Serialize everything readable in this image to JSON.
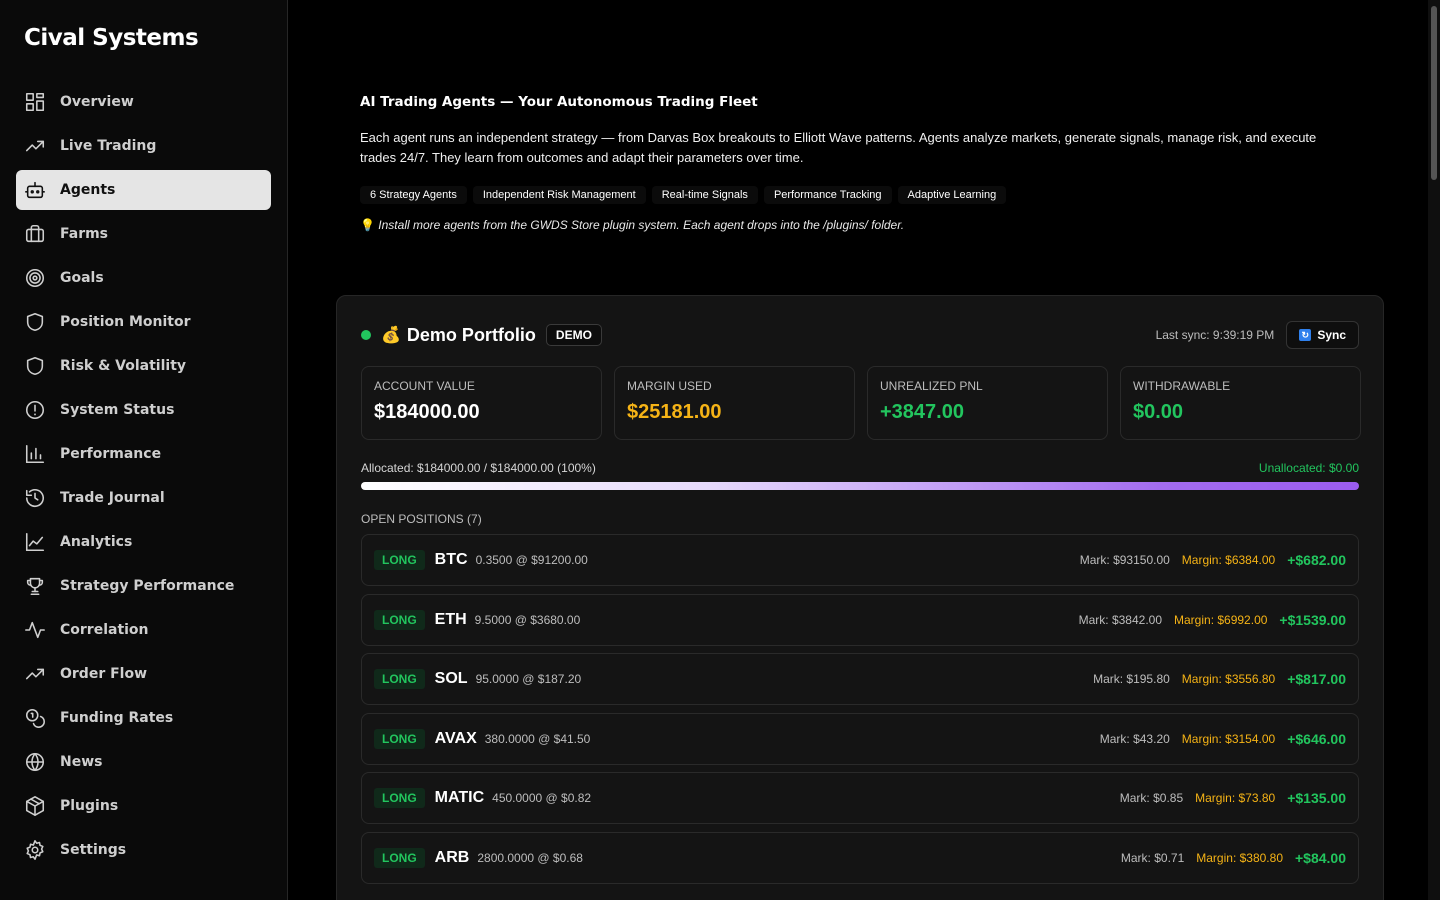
{
  "brand": "Cival Systems",
  "sidebar": {
    "items": [
      {
        "label": "Overview",
        "icon": "grid-icon"
      },
      {
        "label": "Live Trading",
        "icon": "trending-up-icon"
      },
      {
        "label": "Agents",
        "icon": "robot-icon",
        "active": true
      },
      {
        "label": "Farms",
        "icon": "briefcase-icon"
      },
      {
        "label": "Goals",
        "icon": "target-icon"
      },
      {
        "label": "Position Monitor",
        "icon": "shield-icon"
      },
      {
        "label": "Risk & Volatility",
        "icon": "shield-icon"
      },
      {
        "label": "System Status",
        "icon": "alert-circle-icon"
      },
      {
        "label": "Performance",
        "icon": "bar-chart-icon"
      },
      {
        "label": "Trade Journal",
        "icon": "history-icon"
      },
      {
        "label": "Analytics",
        "icon": "line-chart-icon"
      },
      {
        "label": "Strategy Performance",
        "icon": "trophy-icon"
      },
      {
        "label": "Correlation",
        "icon": "activity-icon"
      },
      {
        "label": "Order Flow",
        "icon": "trending-up-icon"
      },
      {
        "label": "Funding Rates",
        "icon": "coins-icon"
      },
      {
        "label": "News",
        "icon": "globe-icon"
      },
      {
        "label": "Plugins",
        "icon": "package-icon"
      },
      {
        "label": "Settings",
        "icon": "gear-icon"
      }
    ]
  },
  "intro": {
    "title": "AI Trading Agents — Your Autonomous Trading Fleet",
    "text": "Each agent runs an independent strategy — from Darvas Box breakouts to Elliott Wave patterns. Agents analyze markets, generate signals, manage risk, and execute trades 24/7. They learn from outcomes and adapt their parameters over time.",
    "tags": [
      "6 Strategy Agents",
      "Independent Risk Management",
      "Real-time Signals",
      "Performance Tracking",
      "Adaptive Learning"
    ],
    "hint_icon": "💡",
    "hint": "Install more agents from the GWDS Store plugin system. Each agent drops into the /plugins/ folder."
  },
  "portfolio": {
    "icon": "💰",
    "name": "Demo Portfolio",
    "badge": "DEMO",
    "last_sync": "Last sync: 9:39:19 PM",
    "sync_label": "Sync",
    "stats": [
      {
        "label": "ACCOUNT VALUE",
        "value": "$184000.00",
        "color": "#ffffff"
      },
      {
        "label": "MARGIN USED",
        "value": "$25181.00",
        "color": "#f5b316"
      },
      {
        "label": "UNREALIZED PNL",
        "value": "+3847.00",
        "color": "#22c55e"
      },
      {
        "label": "WITHDRAWABLE",
        "value": "$0.00",
        "color": "#22c55e"
      }
    ],
    "allocated": "Allocated: $184000.00 / $184000.00 (100%)",
    "unallocated": "Unallocated: $0.00",
    "allocation_fraction": 1.0,
    "positions_title": "OPEN POSITIONS (7)",
    "positions": [
      {
        "side": "LONG",
        "symbol": "BTC",
        "size": "0.3500 @ $91200.00",
        "mark": "Mark: $93150.00",
        "margin": "Margin: $6384.00",
        "pnl": "+$682.00"
      },
      {
        "side": "LONG",
        "symbol": "ETH",
        "size": "9.5000 @ $3680.00",
        "mark": "Mark: $3842.00",
        "margin": "Margin: $6992.00",
        "pnl": "+$1539.00"
      },
      {
        "side": "LONG",
        "symbol": "SOL",
        "size": "95.0000 @ $187.20",
        "mark": "Mark: $195.80",
        "margin": "Margin: $3556.80",
        "pnl": "+$817.00"
      },
      {
        "side": "LONG",
        "symbol": "AVAX",
        "size": "380.0000 @ $41.50",
        "mark": "Mark: $43.20",
        "margin": "Margin: $3154.00",
        "pnl": "+$646.00"
      },
      {
        "side": "LONG",
        "symbol": "MATIC",
        "size": "450.0000 @ $0.82",
        "mark": "Mark: $0.85",
        "margin": "Margin: $73.80",
        "pnl": "+$135.00"
      },
      {
        "side": "LONG",
        "symbol": "ARB",
        "size": "2800.0000 @ $0.68",
        "mark": "Mark: $0.71",
        "margin": "Margin: $380.80",
        "pnl": "+$84.00"
      }
    ]
  }
}
